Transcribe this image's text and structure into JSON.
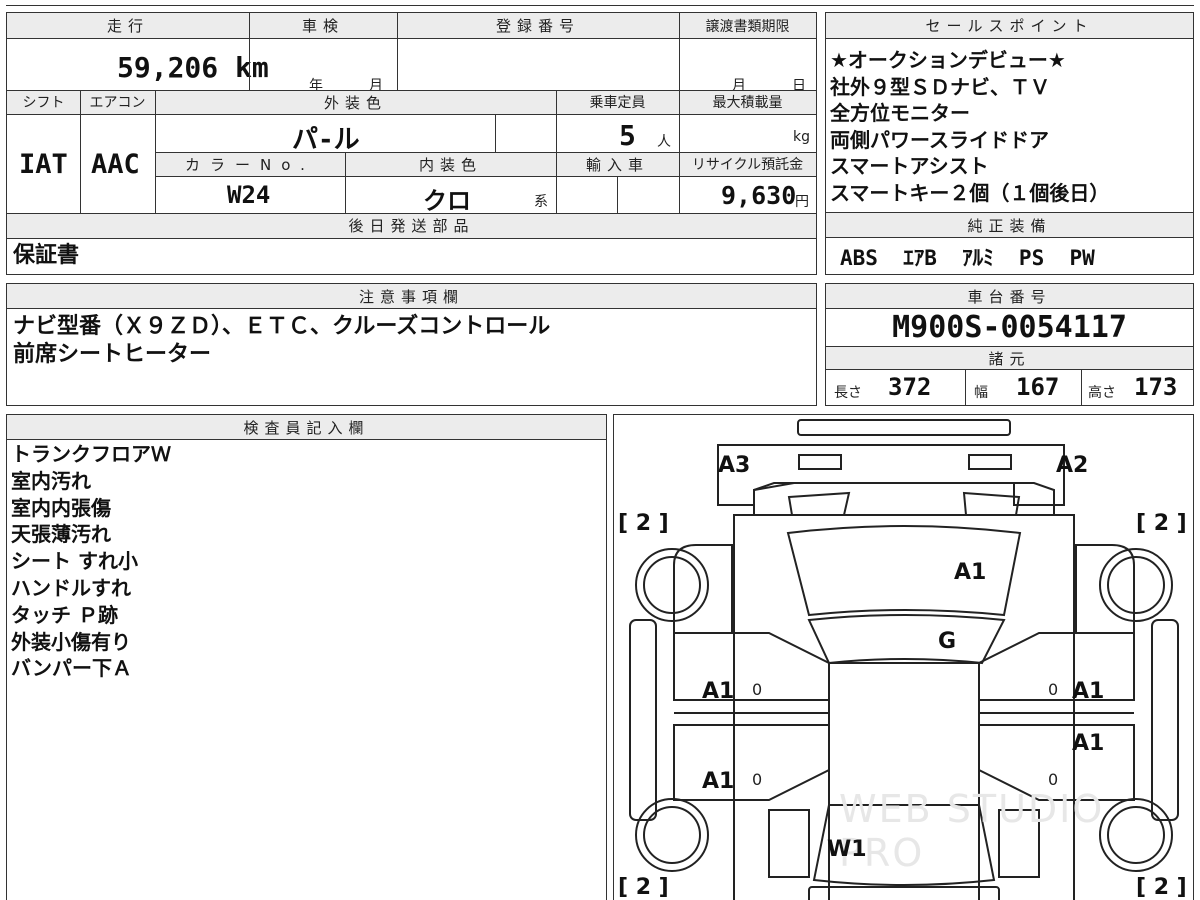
{
  "vehicle_info": {
    "mileage": {
      "label": "走行",
      "value": "59,206 km"
    },
    "inspection": {
      "label": "車検",
      "year_unit": "年",
      "month_unit": "月"
    },
    "registration": {
      "label": "登録番号"
    },
    "transfer_deadline": {
      "label": "譲渡書類期限",
      "month_unit": "月",
      "day_unit": "日"
    },
    "shift": {
      "label": "シフト",
      "value": "IAT"
    },
    "aircon": {
      "label": "エアコン",
      "value": "AAC"
    },
    "exterior_color": {
      "label": "外装色",
      "value": "パ-ル"
    },
    "capacity": {
      "label": "乗車定員",
      "value": "5",
      "unit": "人"
    },
    "max_load": {
      "label": "最大積載量",
      "unit": "kg"
    },
    "color_no": {
      "label": "カラーNo.",
      "value": "W24"
    },
    "interior_color": {
      "label": "内装色",
      "value": "クロ",
      "suffix": "系"
    },
    "import": {
      "label": "輸入車"
    },
    "recycle": {
      "label": "リサイクル預託金",
      "value": "9,630",
      "unit": "円"
    },
    "later_parts": {
      "label": "後日発送部品",
      "value": "保証書"
    }
  },
  "sales_points": {
    "label": "セールスポイント",
    "lines": [
      "★オークションデビュー★",
      "社外９型ＳＤナビ、ＴＶ",
      "全方位モニター",
      "両側パワースライドドア",
      "スマートアシスト",
      "スマートキー２個（１個後日）"
    ]
  },
  "genuine_equipment": {
    "label": "純正装備",
    "value": "ABS  ｴｱB  ｱﾙﾐ  PS  PW"
  },
  "notes": {
    "label": "注意事項欄",
    "lines": [
      "ナビ型番（Ｘ９ＺＤ）、ＥＴＣ、クルーズコントロール",
      "前席シートヒーター"
    ]
  },
  "chassis": {
    "label": "車台番号",
    "value": "M900S-0054117"
  },
  "specs": {
    "label": "諸元",
    "length": {
      "label": "長さ",
      "value": "372"
    },
    "width": {
      "label": "幅",
      "value": "167"
    },
    "height": {
      "label": "高さ",
      "value": "173"
    }
  },
  "inspector": {
    "label": "検査員記入欄",
    "lines": [
      "トランクフロアＷ",
      "室内汚れ",
      "室内内張傷",
      "天張薄汚れ",
      "シート すれ小",
      "ハンドルすれ",
      "タッチ Ｐ跡",
      "外装小傷有り",
      "バンパー下Ａ"
    ]
  },
  "diagram": {
    "marks": {
      "rear_left": "A3",
      "rear_right": "A2",
      "tailgate": "A1",
      "roof": "G",
      "left_rear_door": "A1",
      "left_front_door": "A1",
      "right_rear_door": "A1",
      "right_front_door": "A1",
      "hood": "W1"
    },
    "brackets": [
      "[ 2 ]",
      "[ 2 ]",
      "[ 2 ]",
      "[ 2 ]"
    ],
    "zero_marks": [
      "0",
      "0",
      "0",
      "0"
    ],
    "watermark": "WEB STUDIO PRO"
  }
}
